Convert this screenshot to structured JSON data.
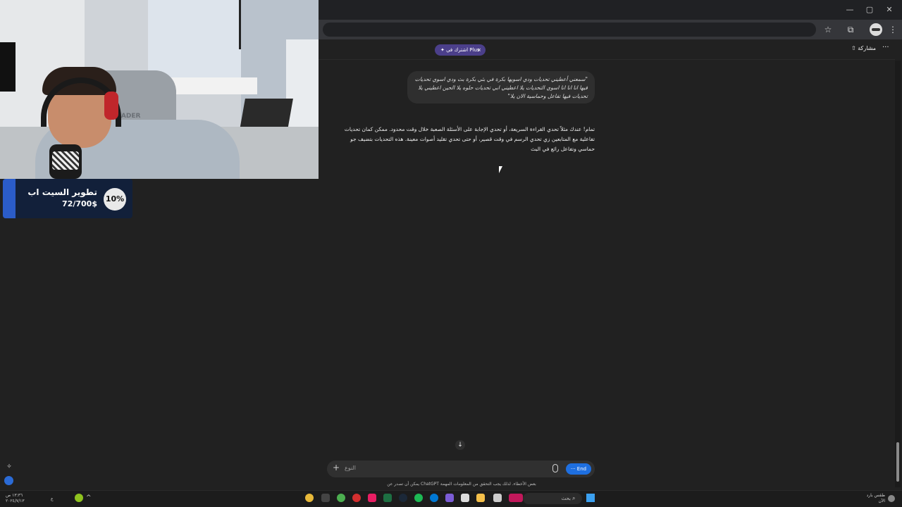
{
  "browser": {
    "window_controls": {
      "minimize": "—",
      "maximize": "▢",
      "close": "✕"
    },
    "toolbar": {
      "bookmark_icon": "star-icon",
      "extensions_icon": "puzzle-icon",
      "menu_icon": "kebab-icon"
    }
  },
  "header": {
    "plus_banner": "اشترك في Plus",
    "plus_banner_close": "×",
    "share_label": "مشاركة",
    "more_label": "···"
  },
  "conversation": {
    "user_message": "\"سمعني أعطيني تحديات ودي اسويها بكرة في بثي بكرة بث ودي اسوي تحديات فيها انا انا انا اسوي التحديات يلا اعطيني ابي تحديات حلوه يلا الحين اعطيني يلا تحديات فيها تفاعل وحماسية الان يلا\"",
    "assistant_message": "تمام! عندك مثلاً تحدي القراءة السريعة، أو تحدي الإجابة على الأسئلة الصعبة خلال وقت محدود. ممكن كمان تحديات تفاعلية مع المتابعين زي تحدي الرسم في وقت قصير، أو حتى تحدي تقليد أصوات معينة. هذه التحديات بتضيف جو حماسي وتفاعل رائع في البث"
  },
  "composer": {
    "placeholder": "النوع",
    "plus_label": "+",
    "end_button": "End",
    "scroll_down_label": "↓",
    "disclaimer": "بعض الأخطاء. لذلك يجب التحقق من المعلومات المهمة ChatGPT يمكن أن تصدر عن"
  },
  "overlay": {
    "goal_title": "تطوير السيت اب",
    "goal_progress": "72/700$",
    "goal_percent": "10%",
    "goal_fraction": 0.1,
    "chair_brand": "RADER"
  },
  "taskbar": {
    "clock_time": "١٣:٣٦ ص",
    "clock_date": "٢٠٢٤/٧/١٣",
    "search_placeholder": "بحث",
    "weather_line1": "طقس بارد",
    "weather_line2": "الآن",
    "lang_indicator": "ع"
  },
  "colors": {
    "background": "#212121",
    "bubble": "#2f2f2f",
    "plus_pill": "#4b3f8a",
    "end_button": "#1e6fe0",
    "goal_bg": "#12203a",
    "goal_fill": "#2b5cc8"
  }
}
